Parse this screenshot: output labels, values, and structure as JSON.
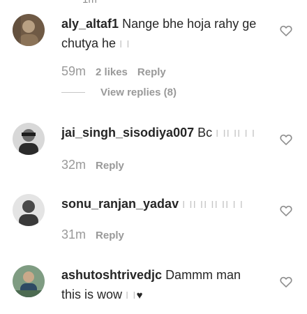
{
  "top_cut_text": "1m",
  "comments": [
    {
      "username": "aly_altaf1",
      "text": "Nange bhe hoja rahy ge chutya he",
      "marks": "I I",
      "time": "59m",
      "likes": "2 likes",
      "reply_label": "Reply",
      "view_replies": "View replies (8)",
      "avatar_colors": [
        "#6f5a45",
        "#b8a083"
      ]
    },
    {
      "username": "jai_singh_sisodiya007",
      "text": "Bc",
      "marks": "I II II I I",
      "time": "32m",
      "reply_label": "Reply",
      "avatar_colors": [
        "#2b2b2b",
        "#8a8a8a"
      ]
    },
    {
      "username": "sonu_ranjan_yadav",
      "text": "",
      "marks": "I II II II II I I",
      "time": "31m",
      "reply_label": "Reply",
      "avatar_colors": [
        "#3a3a3a",
        "#c9c9c9"
      ]
    },
    {
      "username": "ashutoshtrivedjc",
      "text": "Dammm man this is wow",
      "marks": "I I",
      "emoji": "♥",
      "time": "",
      "reply_label": "",
      "avatar_colors": [
        "#4d6b52",
        "#2e4a63"
      ]
    }
  ],
  "icons": {
    "like": "heart-outline-icon"
  },
  "colors": {
    "text": "#262626",
    "muted": "#999999",
    "marks": "#c7c7c7"
  }
}
